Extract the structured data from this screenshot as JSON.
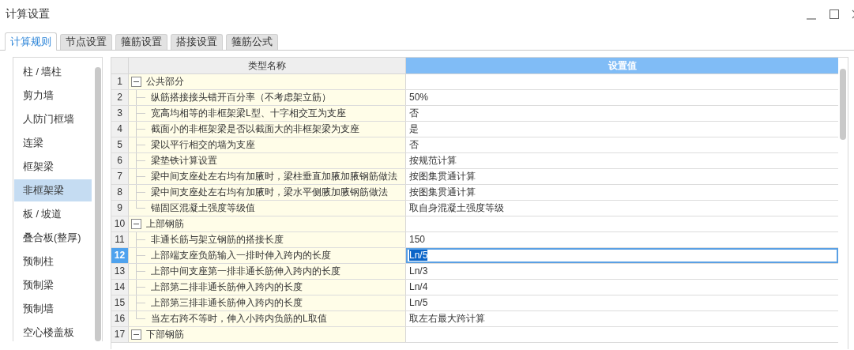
{
  "window": {
    "title": "计算设置"
  },
  "tabs": [
    {
      "label": "计算规则",
      "selected": true
    },
    {
      "label": "节点设置",
      "selected": false
    },
    {
      "label": "箍筋设置",
      "selected": false
    },
    {
      "label": "搭接设置",
      "selected": false
    },
    {
      "label": "箍筋公式",
      "selected": false
    }
  ],
  "sidebar": {
    "items": [
      {
        "label": "柱 / 墙柱",
        "selected": false
      },
      {
        "label": "剪力墙",
        "selected": false
      },
      {
        "label": "人防门框墙",
        "selected": false
      },
      {
        "label": "连梁",
        "selected": false
      },
      {
        "label": "框架梁",
        "selected": false
      },
      {
        "label": "非框架梁",
        "selected": true
      },
      {
        "label": "板 / 坡道",
        "selected": false
      },
      {
        "label": "叠合板(整厚)",
        "selected": false
      },
      {
        "label": "预制柱",
        "selected": false
      },
      {
        "label": "预制梁",
        "selected": false
      },
      {
        "label": "预制墙",
        "selected": false
      },
      {
        "label": "空心楼盖板",
        "selected": false
      }
    ]
  },
  "table": {
    "columns": [
      "类型名称",
      "设置值"
    ],
    "rows": [
      {
        "number": "1",
        "kind": "group",
        "name": "公共部分",
        "expanded": true,
        "selected": false
      },
      {
        "number": "2",
        "kind": "item",
        "name": "纵筋搭接接头错开百分率（不考虑架立筋）",
        "value": "50%",
        "selected": false
      },
      {
        "number": "3",
        "kind": "item",
        "name": "宽高均相等的非框架梁L型、十字相交互为支座",
        "value": "否",
        "selected": false
      },
      {
        "number": "4",
        "kind": "item",
        "name": "截面小的非框架梁是否以截面大的非框架梁为支座",
        "value": "是",
        "selected": false
      },
      {
        "number": "5",
        "kind": "item",
        "name": "梁以平行相交的墙为支座",
        "value": "否",
        "selected": false
      },
      {
        "number": "6",
        "kind": "item",
        "name": "梁垫铁计算设置",
        "value": "按规范计算",
        "selected": false
      },
      {
        "number": "7",
        "kind": "item",
        "name": "梁中间支座处左右均有加腋时，梁柱垂直加腋加腋钢筋做法",
        "value": "按图集贯通计算",
        "selected": false
      },
      {
        "number": "8",
        "kind": "item",
        "name": "梁中间支座处左右均有加腋时，梁水平侧腋加腋钢筋做法",
        "value": "按图集贯通计算",
        "selected": false
      },
      {
        "number": "9",
        "kind": "item",
        "name": "锚固区混凝土强度等级值",
        "value": "取自身混凝土强度等级",
        "selected": false
      },
      {
        "number": "10",
        "kind": "group",
        "name": "上部钢筋",
        "expanded": true,
        "selected": false
      },
      {
        "number": "11",
        "kind": "item",
        "name": "非通长筋与架立钢筋的搭接长度",
        "value": "150",
        "selected": false
      },
      {
        "number": "12",
        "kind": "item",
        "name": "上部端支座负筋输入一排时伸入跨内的长度",
        "value": "Ln/5",
        "selected": true
      },
      {
        "number": "13",
        "kind": "item",
        "name": "上部中间支座第一排非通长筋伸入跨内的长度",
        "value": "Ln/3",
        "selected": false
      },
      {
        "number": "14",
        "kind": "item",
        "name": "上部第二排非通长筋伸入跨内的长度",
        "value": "Ln/4",
        "selected": false
      },
      {
        "number": "15",
        "kind": "item",
        "name": "上部第三排非通长筋伸入跨内的长度",
        "value": "Ln/5",
        "selected": false
      },
      {
        "number": "16",
        "kind": "item",
        "name": "当左右跨不等时，伸入小跨内负筋的L取值",
        "value": "取左右最大跨计算",
        "selected": false
      },
      {
        "number": "17",
        "kind": "group",
        "name": "下部钢筋",
        "expanded": true,
        "selected": false
      }
    ]
  }
}
